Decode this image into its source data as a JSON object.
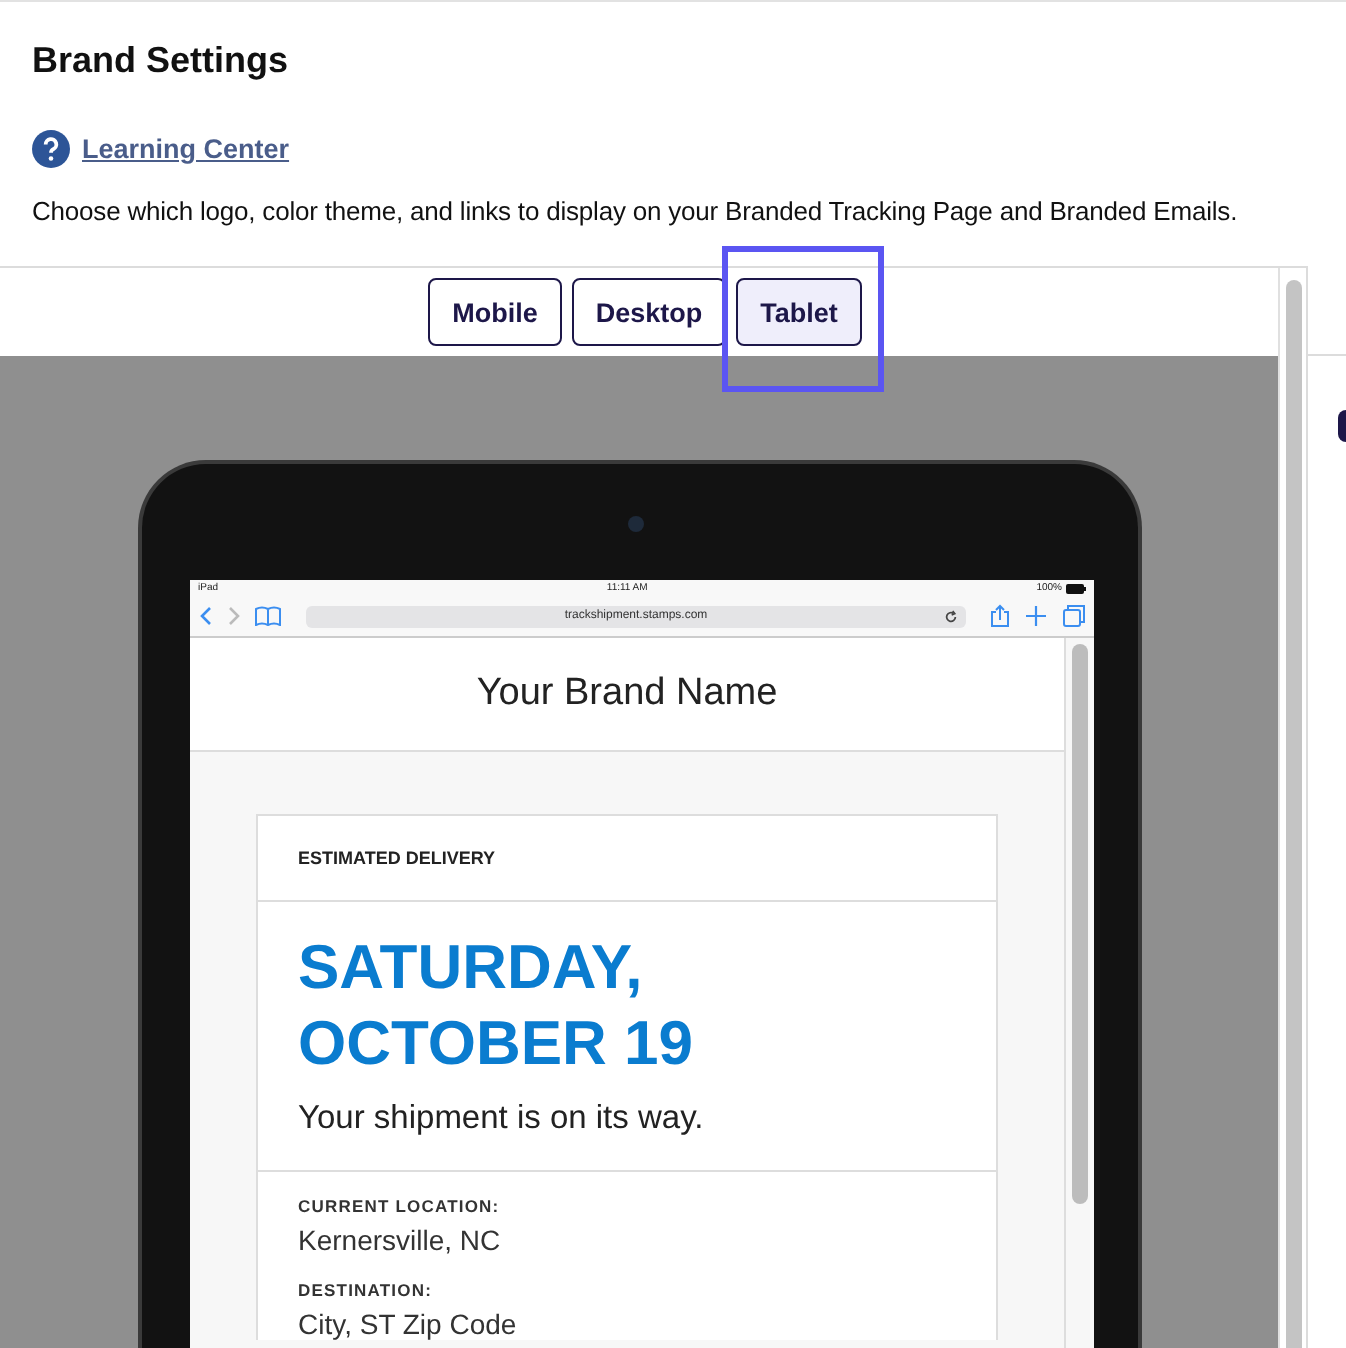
{
  "page": {
    "title": "Brand Settings",
    "help_link": "Learning Center",
    "description": "Choose which logo, color theme, and links to display on your Branded Tracking Page and Branded Emails."
  },
  "preview": {
    "tabs": [
      {
        "label": "Mobile",
        "selected": false
      },
      {
        "label": "Desktop",
        "selected": false
      },
      {
        "label": "Tablet",
        "selected": true
      }
    ],
    "device": {
      "status_bar": {
        "device": "iPad",
        "time": "11:11 AM",
        "battery": "100%"
      },
      "url": "trackshipment.stamps.com",
      "brand_name": "Your Brand Name",
      "delivery_card": {
        "heading": "ESTIMATED DELIVERY",
        "date": "SATURDAY, OCTOBER 19",
        "status": "Your shipment is on its way.",
        "details": [
          {
            "label": "CURRENT LOCATION:",
            "value": "Kernersville, NC"
          },
          {
            "label": "DESTINATION:",
            "value": "City, ST Zip Code"
          }
        ]
      }
    }
  }
}
